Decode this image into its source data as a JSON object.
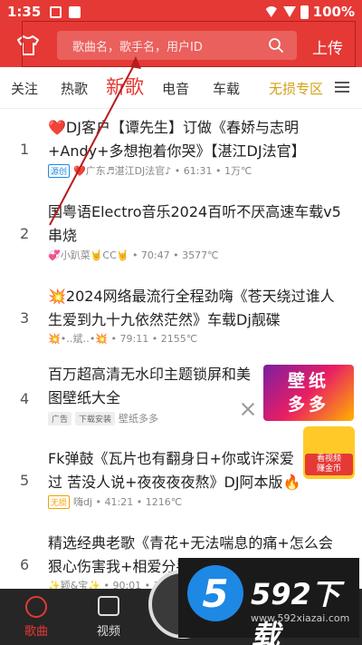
{
  "statusbar": {
    "time": "1:35",
    "battery": "100%"
  },
  "header": {
    "search_placeholder": "歌曲名，歌手名，用户ID",
    "upload_label": "上传"
  },
  "tabs": [
    {
      "label": "关注"
    },
    {
      "label": "热歌"
    },
    {
      "label": "新歌"
    },
    {
      "label": "电音"
    },
    {
      "label": "车载"
    },
    {
      "label": "无损专区"
    }
  ],
  "songs": [
    {
      "num": "1",
      "title": "❤️DJ客户【谭先生】订做《春娇与志明+Andy+多想抱着你哭》【湛江DJ法官】",
      "tag": "源创",
      "meta": "❤️广东♬湛江DJ法官♪ • 61:31 • 1万℃"
    },
    {
      "num": "2",
      "title": "国粤语Electro音乐2024百听不厌高速车载v5串烧",
      "meta": "💞小趴菜🤘CC🤘 • 70:47 • 3577℃"
    },
    {
      "num": "3",
      "title": "💥2024网络最流行全程劲嗨《苍天绕过谁人生爱到九十九依然茫然》车载Dj靓碟",
      "meta": "💥•‥斌‥•💥 • 79:11 • 2155℃"
    },
    {
      "num": "4",
      "title": "百万超高清无水印主题锁屏和美图壁纸大全",
      "tag1": "广告",
      "tag2": "下载安装",
      "meta": "壁纸多多"
    },
    {
      "num": "5",
      "title": "Fk弹鼓《瓦片也有翻身日+你或许深爱过 苦没人说+夜夜夜夜熬》DJ阿本版🔥",
      "tag": "无损",
      "meta": "嗨dj • 41:21 • 1216℃"
    },
    {
      "num": "6",
      "title": "精选经典老歌《青花+无法喘息的痛+怎么会狠心伤害我+相爱分手",
      "meta": "✨颖&宝✨ • 90:01 • 1"
    }
  ],
  "ad": {
    "image_text_1": "壁纸",
    "image_text_2": "多多",
    "coin_label_1": "看视频",
    "coin_label_2": "赚金币"
  },
  "bottomnav": [
    {
      "label": "歌曲"
    },
    {
      "label": "视频"
    }
  ],
  "watermark": {
    "title": "592下载",
    "badge": "5",
    "url": "www.592xiazai.com"
  },
  "colors": {
    "brand": "#e53935",
    "gold": "#d4a017",
    "tag_blue": "#1e88e5"
  }
}
